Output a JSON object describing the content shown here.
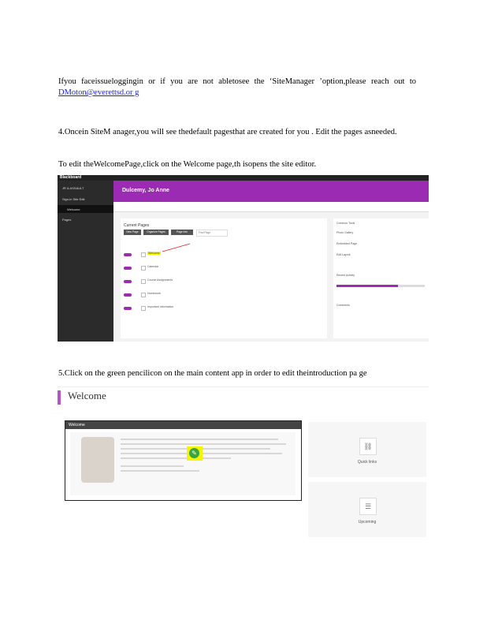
{
  "paragraphs": {
    "p1_text": "Ifyou faceissueloggingin or if you are not abletosee the ‘SiteManager ’option,please reach out to ",
    "p1_link": "DMoton@everettsd.or g",
    "p2_text": "4.Oncein SiteM anager,you will see thedefault pagesthat are created for you . Edit the pages asneeded.",
    "p3_text": "To edit theWelcomePage,click on the Welcome page,th isopens the site editor.",
    "p4_text": "5.Click on the green pencilicon on the main content app in order to edit theintroduction pa ge"
  },
  "screenshot1": {
    "logo": "Blackboard",
    "banner_title": "Dulcemy, Jo Anne",
    "panel_title": "Current Pages",
    "buttons": [
      "New Page",
      "Organize Pages",
      "Page Info",
      "Find Page"
    ],
    "rows": [
      "Welcome",
      "Calendar",
      "Course Assignments",
      "Homework",
      "Important Information"
    ],
    "sidebar": [
      "JR & ASSAULT",
      "Sign-in Site Edit",
      "Welcome",
      "Pages"
    ],
    "right_panel": [
      "Common Tools",
      "Photo Gallery",
      "Embedded Page",
      "Edit Layout",
      "Recent Activity",
      "Comments"
    ]
  },
  "screenshot2": {
    "title": "Welcome",
    "card_label": "Welcome",
    "side_labels": [
      "Quick links",
      "Upcoming"
    ]
  },
  "colors": {
    "purple": "#9b2bb3",
    "highlight": "#f5f500",
    "pencil_green": "#3da33d",
    "link": "#1a1aff"
  }
}
